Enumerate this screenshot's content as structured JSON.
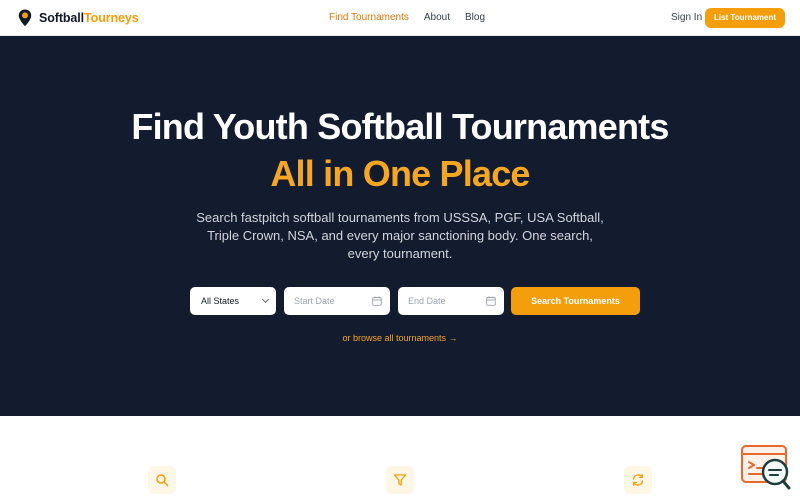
{
  "brand": {
    "name_part1": "Softball",
    "name_part2": "Tourneys",
    "icon": "map-pin-icon"
  },
  "nav": {
    "links": [
      {
        "label": "Find Tournaments",
        "active": true
      },
      {
        "label": "About",
        "active": false
      },
      {
        "label": "Blog",
        "active": false
      }
    ]
  },
  "header": {
    "signin_label": "Sign In",
    "list_button_label": "List Tournament"
  },
  "hero": {
    "title_line1": "Find Youth Softball Tournaments",
    "title_line2": "All in One Place",
    "subtitle": "Search fastpitch softball tournaments from USSSA, PGF, USA Softball, Triple Crown, NSA, and every major sanctioning body. One search, every tournament."
  },
  "search": {
    "state_select": "All States",
    "start_date_placeholder": "Start Date",
    "end_date_placeholder": "End Date",
    "button_label": "Search Tournaments",
    "browse_link": "or browse all tournaments →"
  },
  "features": {
    "icons": [
      "search-icon",
      "filter-icon",
      "refresh-icon"
    ]
  },
  "colors": {
    "accent": "#f59e0b",
    "hero_bg": "#131b2f",
    "highlight": "#f5a623"
  }
}
